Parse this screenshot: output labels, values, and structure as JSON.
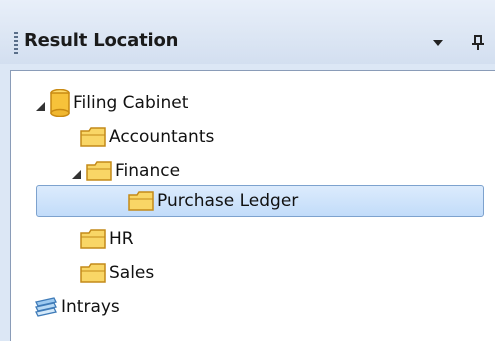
{
  "panel": {
    "title": "Result Location"
  },
  "tree": {
    "root": {
      "label": "Filing Cabinet",
      "icon": "cylinder-icon",
      "expanded": true
    },
    "children": [
      {
        "label": "Accountants",
        "icon": "folder-icon"
      },
      {
        "label": "Finance",
        "icon": "folder-icon",
        "expanded": true,
        "children": [
          {
            "label": "Purchase Ledger",
            "icon": "folder-icon",
            "selected": true
          }
        ]
      },
      {
        "label": "HR",
        "icon": "folder-icon"
      },
      {
        "label": "Sales",
        "icon": "folder-icon"
      }
    ],
    "intrays": {
      "label": "Intrays",
      "icon": "intrays-icon"
    }
  },
  "colors": {
    "header_bg": "#dce7f5",
    "selection": "#c2dcfa",
    "folder": "#f6c240"
  }
}
